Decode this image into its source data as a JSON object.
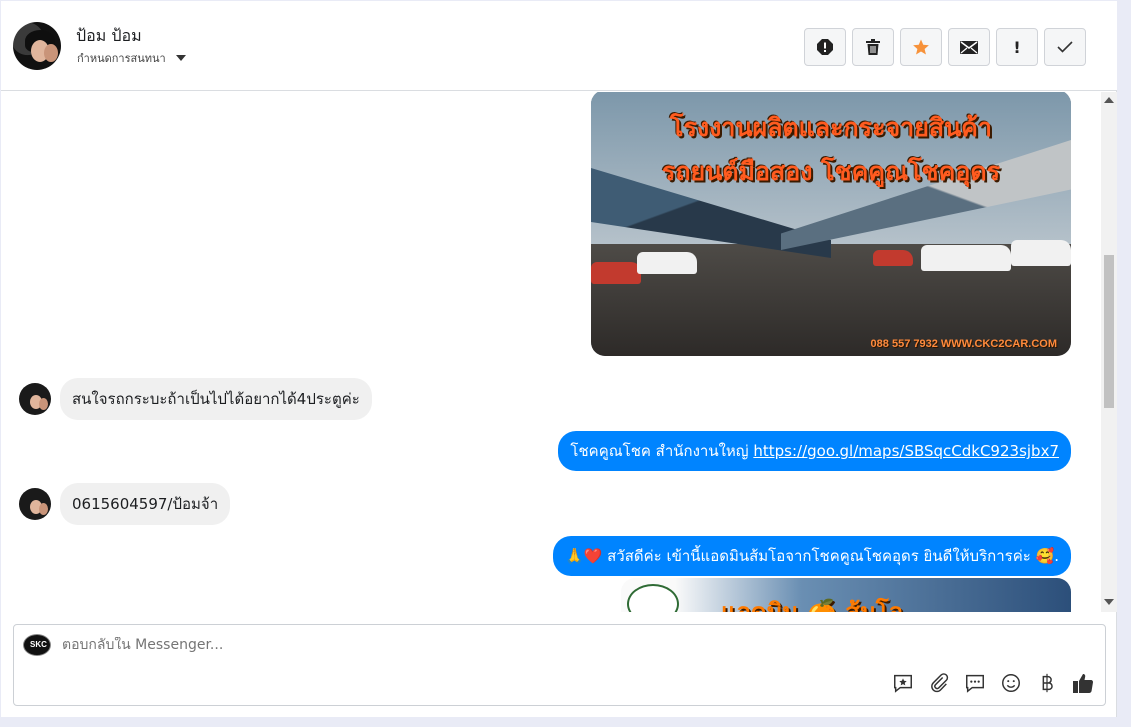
{
  "header": {
    "contact_name": "ป้อม ป้อม",
    "assign_label": "กำหนดการสนทนา",
    "actions": [
      "spam-icon",
      "trash-icon",
      "star-icon",
      "envelope-icon",
      "exclamation-icon",
      "check-icon"
    ],
    "star_color": "#f7923a"
  },
  "messages": {
    "image1": {
      "title_line1": "โรงงานผลิตและกระจายสินค้า",
      "title_line2": "รถยนต์มือสอง โชคคูณโชคอุดร",
      "footer": "088 557 7932 WWW.CKC2CAR.COM"
    },
    "incoming1": "สนใจรถกระบะถ้าเป็นไปได้อยากได้4ประตูค่ะ",
    "outgoing1_text": "โชคคูณโชค สำนักงานใหญ่ ",
    "outgoing1_link": "https://goo.gl/maps/SBSqcCdkC923sjbx7",
    "incoming2": "0615604597/ป้อมจ้า",
    "outgoing2": "🙏❤️ สวัสดีค่ะ เข้านี้แอดมินส้มโอจากโชคคูณโชคอุดร ยินดีให้บริการค่ะ 🥰.",
    "image2_text": "แอดมิน 🍊 ส้มโอ"
  },
  "composer": {
    "page_avatar_label": "SKC",
    "placeholder": "ตอบกลับใน Messenger...",
    "tools": [
      "saved-reply-icon",
      "attachment-icon",
      "chat-icon",
      "emoji-icon",
      "baht-icon",
      "like-icon"
    ]
  },
  "colors": {
    "outgoing_bubble": "#0084ff",
    "incoming_bubble": "#f0f0f0"
  }
}
